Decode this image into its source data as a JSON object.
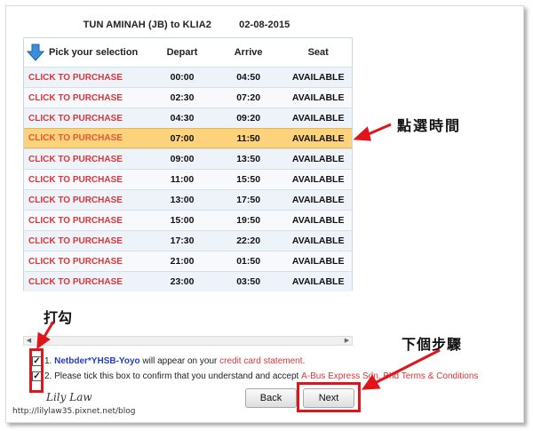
{
  "route": {
    "title": "TUN AMINAH (JB) to KLIA2",
    "date": "02-08-2015"
  },
  "table": {
    "headers": {
      "pick": "Pick your selection",
      "depart": "Depart",
      "arrive": "Arrive",
      "seat": "Seat"
    },
    "selected_index": 3,
    "rows": [
      {
        "action": "CLICK TO PURCHASE",
        "depart": "00:00",
        "arrive": "04:50",
        "seat": "AVAILABLE"
      },
      {
        "action": "CLICK TO PURCHASE",
        "depart": "02:30",
        "arrive": "07:20",
        "seat": "AVAILABLE"
      },
      {
        "action": "CLICK TO PURCHASE",
        "depart": "04:30",
        "arrive": "09:20",
        "seat": "AVAILABLE"
      },
      {
        "action": "CLICK TO PURCHASE",
        "depart": "07:00",
        "arrive": "11:50",
        "seat": "AVAILABLE"
      },
      {
        "action": "CLICK TO PURCHASE",
        "depart": "09:00",
        "arrive": "13:50",
        "seat": "AVAILABLE"
      },
      {
        "action": "CLICK TO PURCHASE",
        "depart": "11:00",
        "arrive": "15:50",
        "seat": "AVAILABLE"
      },
      {
        "action": "CLICK TO PURCHASE",
        "depart": "13:00",
        "arrive": "17:50",
        "seat": "AVAILABLE"
      },
      {
        "action": "CLICK TO PURCHASE",
        "depart": "15:00",
        "arrive": "19:50",
        "seat": "AVAILABLE"
      },
      {
        "action": "CLICK TO PURCHASE",
        "depart": "17:30",
        "arrive": "22:20",
        "seat": "AVAILABLE"
      },
      {
        "action": "CLICK TO PURCHASE",
        "depart": "21:00",
        "arrive": "01:50",
        "seat": "AVAILABLE"
      },
      {
        "action": "CLICK TO PURCHASE",
        "depart": "23:00",
        "arrive": "03:50",
        "seat": "AVAILABLE"
      }
    ]
  },
  "terms": {
    "t1_num": "1.",
    "t1_brand": "Netbder*YHSB-Yoyo",
    "t1_mid": "will appear on your",
    "t1_link": "credit card statement.",
    "t2_num": "2.",
    "t2_text": "Please tick this box to confirm that you understand and accept",
    "t2_link": "A-Bus Express Sdn. Bhd Terms & Conditions"
  },
  "buttons": {
    "back": "Back",
    "next": "Next"
  },
  "annotations": {
    "select_time": "點選時間",
    "tick": "打勾",
    "next_step": "下個步驟"
  },
  "watermark": {
    "signature": "Lily Law",
    "url": "http://lilylaw35.pixnet.net/blog"
  },
  "colors": {
    "accent_red": "#e0151b",
    "link_red": "#d9373a",
    "highlight": "#fcd27b",
    "brand_blue": "#1f3fbf"
  }
}
